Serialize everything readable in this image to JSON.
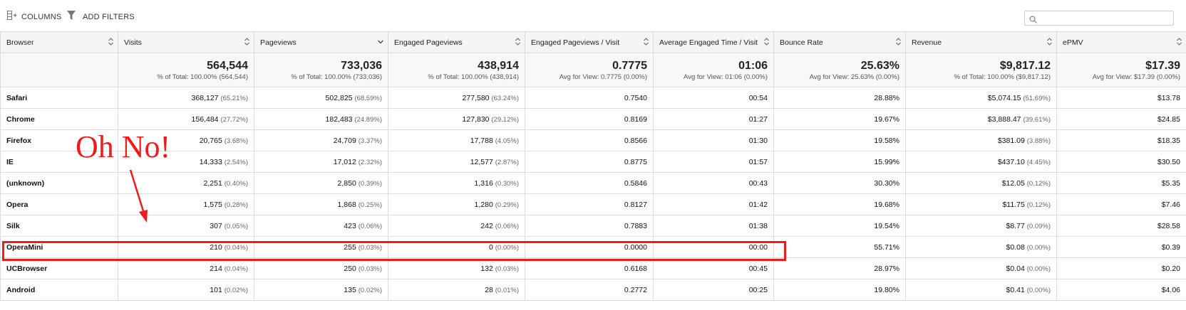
{
  "toolbar": {
    "columns_label": "COLUMNS",
    "filters_label": "ADD FILTERS",
    "search_placeholder": ""
  },
  "table": {
    "headers": [
      "Browser",
      "Visits",
      "Pageviews",
      "Engaged Pageviews",
      "Engaged Pageviews / Visit",
      "Average Engaged Time / Visit",
      "Bounce Rate",
      "Revenue",
      "ePMV"
    ],
    "totals": [
      {
        "value": "",
        "sub": ""
      },
      {
        "value": "564,544",
        "sub": "% of Total: 100.00% (564,544)"
      },
      {
        "value": "733,036",
        "sub": "% of Total: 100.00% (733,036)"
      },
      {
        "value": "438,914",
        "sub": "% of Total: 100.00% (438,914)"
      },
      {
        "value": "0.7775",
        "sub": "Avg for View: 0.7775 (0.00%)"
      },
      {
        "value": "01:06",
        "sub": "Avg for View: 01:06 (0.00%)"
      },
      {
        "value": "25.63%",
        "sub": "Avg for View: 25.63% (0.00%)"
      },
      {
        "value": "$9,817.12",
        "sub": "% of Total: 100.00% ($9,817.12)"
      },
      {
        "value": "$17.39",
        "sub": "Avg for View: $17.39 (0.00%)"
      }
    ],
    "rows": [
      {
        "browser": "Safari",
        "visits": "368,127",
        "visits_pct": "(65.21%)",
        "pageviews": "502,825",
        "pageviews_pct": "(68.59%)",
        "engaged": "277,580",
        "engaged_pct": "(63.24%)",
        "epv": "0.7540",
        "aet": "00:54",
        "bounce": "28.88%",
        "revenue": "$5,074.15",
        "revenue_pct": "(51.69%)",
        "epmv": "$13.78"
      },
      {
        "browser": "Chrome",
        "visits": "156,484",
        "visits_pct": "(27.72%)",
        "pageviews": "182,483",
        "pageviews_pct": "(24.89%)",
        "engaged": "127,830",
        "engaged_pct": "(29.12%)",
        "epv": "0.8169",
        "aet": "01:27",
        "bounce": "19.67%",
        "revenue": "$3,888.47",
        "revenue_pct": "(39.61%)",
        "epmv": "$24.85"
      },
      {
        "browser": "Firefox",
        "visits": "20,765",
        "visits_pct": "(3.68%)",
        "pageviews": "24,709",
        "pageviews_pct": "(3.37%)",
        "engaged": "17,788",
        "engaged_pct": "(4.05%)",
        "epv": "0.8566",
        "aet": "01:30",
        "bounce": "19.58%",
        "revenue": "$381.09",
        "revenue_pct": "(3.88%)",
        "epmv": "$18.35"
      },
      {
        "browser": "IE",
        "visits": "14,333",
        "visits_pct": "(2.54%)",
        "pageviews": "17,012",
        "pageviews_pct": "(2.32%)",
        "engaged": "12,577",
        "engaged_pct": "(2.87%)",
        "epv": "0.8775",
        "aet": "01:57",
        "bounce": "15.99%",
        "revenue": "$437.10",
        "revenue_pct": "(4.45%)",
        "epmv": "$30.50"
      },
      {
        "browser": "(unknown)",
        "visits": "2,251",
        "visits_pct": "(0.40%)",
        "pageviews": "2,850",
        "pageviews_pct": "(0.39%)",
        "engaged": "1,316",
        "engaged_pct": "(0.30%)",
        "epv": "0.5846",
        "aet": "00:43",
        "bounce": "30.30%",
        "revenue": "$12.05",
        "revenue_pct": "(0.12%)",
        "epmv": "$5.35"
      },
      {
        "browser": "Opera",
        "visits": "1,575",
        "visits_pct": "(0.28%)",
        "pageviews": "1,868",
        "pageviews_pct": "(0.25%)",
        "engaged": "1,280",
        "engaged_pct": "(0.29%)",
        "epv": "0.8127",
        "aet": "01:42",
        "bounce": "19.68%",
        "revenue": "$11.75",
        "revenue_pct": "(0.12%)",
        "epmv": "$7.46"
      },
      {
        "browser": "Silk",
        "visits": "307",
        "visits_pct": "(0.05%)",
        "pageviews": "423",
        "pageviews_pct": "(0.06%)",
        "engaged": "242",
        "engaged_pct": "(0.06%)",
        "epv": "0.7883",
        "aet": "01:38",
        "bounce": "19.54%",
        "revenue": "$8.77",
        "revenue_pct": "(0.09%)",
        "epmv": "$28.58"
      },
      {
        "browser": "OperaMini",
        "visits": "210",
        "visits_pct": "(0.04%)",
        "pageviews": "255",
        "pageviews_pct": "(0.03%)",
        "engaged": "0",
        "engaged_pct": "(0.00%)",
        "epv": "0.0000",
        "aet": "00:00",
        "bounce": "55.71%",
        "revenue": "$0.08",
        "revenue_pct": "(0.00%)",
        "epmv": "$0.39"
      },
      {
        "browser": "UCBrowser",
        "visits": "214",
        "visits_pct": "(0.04%)",
        "pageviews": "250",
        "pageviews_pct": "(0.03%)",
        "engaged": "132",
        "engaged_pct": "(0.03%)",
        "epv": "0.6168",
        "aet": "00:45",
        "bounce": "28.97%",
        "revenue": "$0.04",
        "revenue_pct": "(0.00%)",
        "epmv": "$0.20"
      },
      {
        "browser": "Android",
        "visits": "101",
        "visits_pct": "(0.02%)",
        "pageviews": "135",
        "pageviews_pct": "(0.02%)",
        "engaged": "28",
        "engaged_pct": "(0.01%)",
        "epv": "0.2772",
        "aet": "00:25",
        "bounce": "19.80%",
        "revenue": "$0.41",
        "revenue_pct": "(0.00%)",
        "epmv": "$4.06"
      }
    ]
  },
  "annotation": {
    "text": "Oh No!",
    "color": "#ee1c1c",
    "highlighted_row": "OperaMini"
  },
  "icons": {
    "columns": "columns-icon",
    "filters": "filter-icon",
    "search": "search-icon",
    "sort": "sort-icon",
    "sort_desc": "chevron-down-icon"
  }
}
